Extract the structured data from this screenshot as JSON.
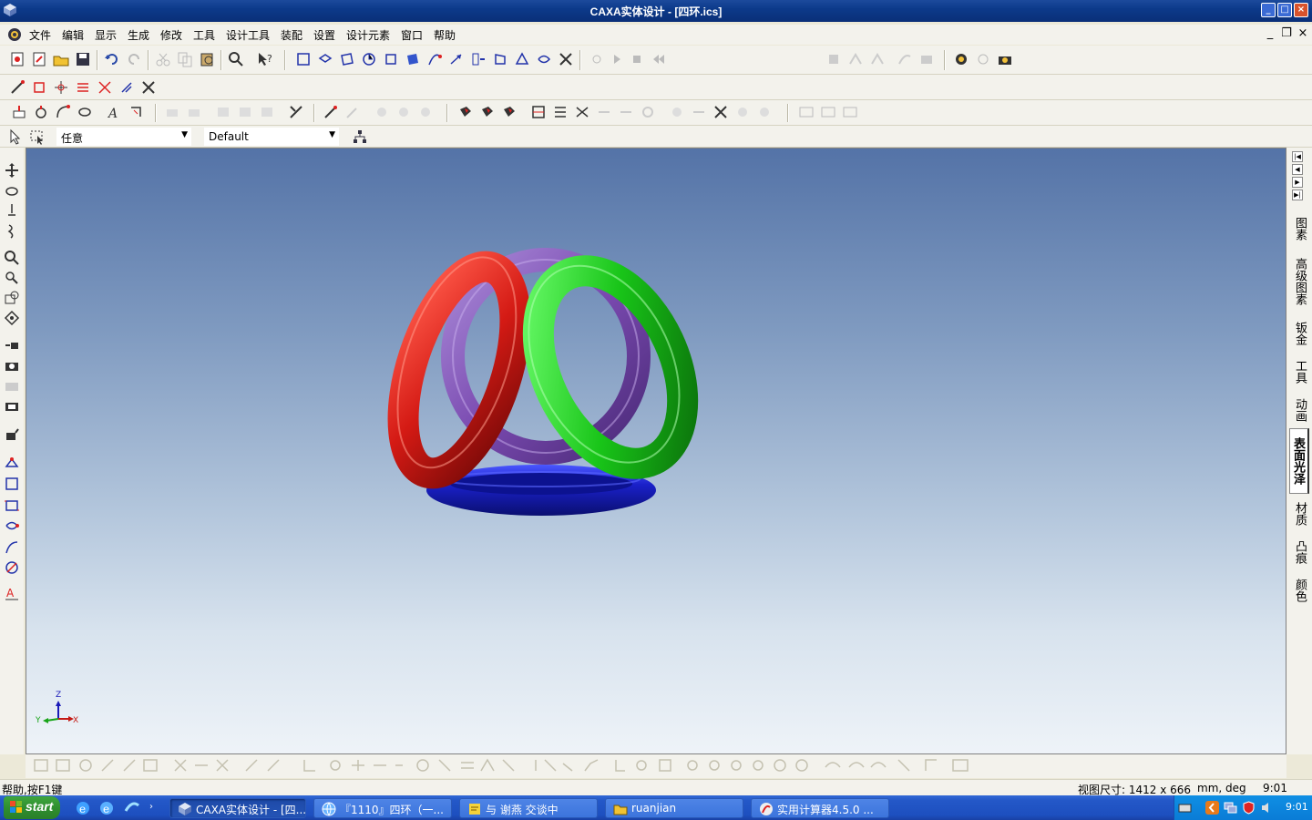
{
  "window": {
    "title": "CAXA实体设计 - [四环.ics]",
    "min_label": "_",
    "max_label": "□",
    "close_label": "×"
  },
  "menu": {
    "items": [
      "文件",
      "编辑",
      "显示",
      "生成",
      "修改",
      "工具",
      "设计工具",
      "装配",
      "设置",
      "设计元素",
      "窗口",
      "帮助"
    ],
    "mdi_min": "_",
    "mdi_restore": "❐",
    "mdi_close": "×"
  },
  "selection_bar": {
    "filter_value": "任意",
    "style_value": "Default"
  },
  "right_tabs": [
    "图素",
    "高级图素",
    "钣金",
    "工具",
    "动画",
    "表面光泽",
    "材质",
    "凸痕",
    "颜色"
  ],
  "right_tabs_active": "表面光泽",
  "right_nav": [
    "|◀",
    "◀",
    "▶",
    "▶|"
  ],
  "scene": {
    "rings": [
      {
        "name": "blue-torus",
        "color": "#1a20c8"
      },
      {
        "name": "purple-torus",
        "color": "#7a4ab0"
      },
      {
        "name": "red-torus",
        "color": "#d41a14"
      },
      {
        "name": "green-torus",
        "color": "#18c418"
      }
    ],
    "triad": {
      "z_label": "Z",
      "y_label": "Y",
      "x_label": "X"
    }
  },
  "status": {
    "help_text": "帮助,按F1键",
    "view_size": "视图尺寸: 1412 x 666",
    "units": "mm, deg",
    "time": "9:01"
  },
  "taskbar": {
    "start_label": "start",
    "tasks": [
      {
        "label": "CAXA实体设计 - [四...",
        "active": true
      },
      {
        "label": "『1110』四环（一...",
        "active": false
      },
      {
        "label": "与 谢燕 交谈中",
        "active": false
      },
      {
        "label": "ruanjian",
        "active": false
      },
      {
        "label": "实用计算器4.5.0 ...",
        "active": false
      }
    ],
    "clock": "9:01"
  }
}
